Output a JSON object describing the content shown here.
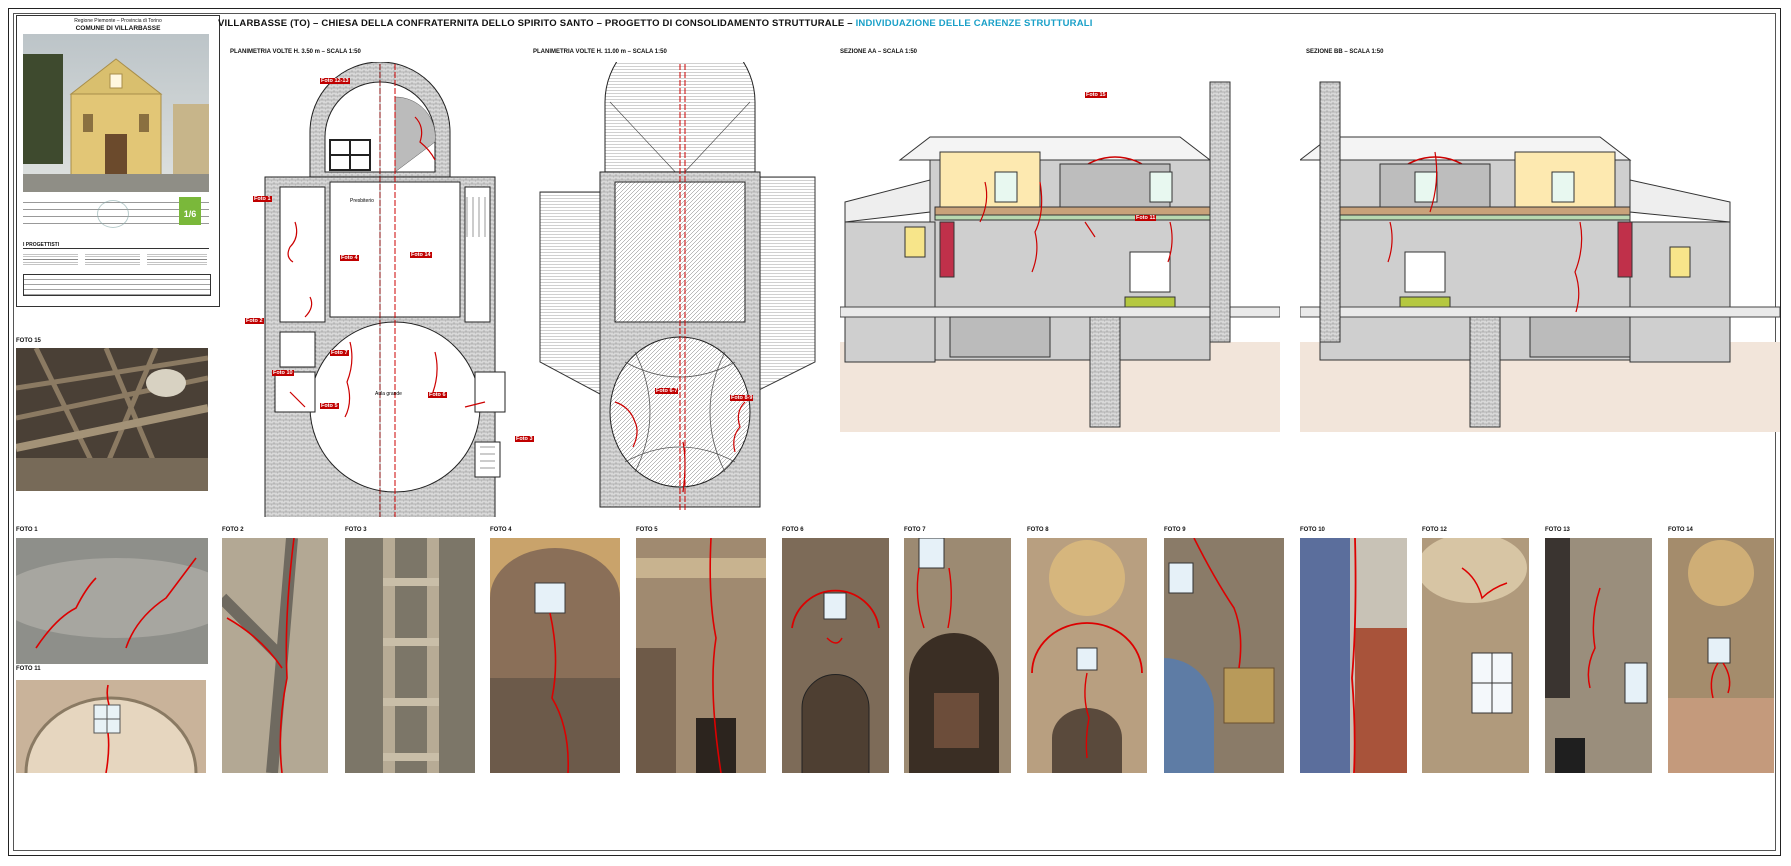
{
  "title_block": {
    "region": "Regione Piemonte – Provincia di Torino",
    "comune": "COMUNE DI VILLARBASSE",
    "sheet_number": "1/6",
    "designers_heading": "I PROGETTISTI"
  },
  "header": {
    "title_main": "VILLARBASSE (TO) – CHIESA DELLA CONFRATERNITA DELLO SPIRITO SANTO – PROGETTO DI CONSOLIDAMENTO STRUTTURALE –",
    "title_highlight": "INDIVIDUAZIONE DELLE CARENZE STRUTTURALI"
  },
  "drawings": {
    "plan1_label": "PLANIMETRIA VOLTE H. 3.50 m – SCALA 1:50",
    "plan2_label": "PLANIMETRIA VOLTE H. 11.00 m – SCALA 1:50",
    "section_aa_label": "SEZIONE AA – SCALA 1:50",
    "section_bb_label": "SEZIONE BB – SCALA 1:50"
  },
  "plan_rooms": {
    "presbiterio": "Presbiterio",
    "aula": "Aula grande"
  },
  "annotations": [
    "Foto 12-13",
    "Foto 1",
    "Foto 4",
    "Foto 14",
    "Foto 2",
    "Foto 10",
    "Foto 7",
    "Foto 6",
    "Foto 5",
    "Foto 3",
    "Foto 6-7",
    "Foto 8-9",
    "Foto 11",
    "Foto 15"
  ],
  "photos": {
    "foto15": "FOTO 15",
    "foto1": "FOTO 1",
    "foto11": "FOTO 11",
    "foto2": "FOTO 2",
    "foto3": "FOTO 3",
    "foto4": "FOTO 4",
    "foto5": "FOTO 5",
    "foto6": "FOTO 6",
    "foto7": "FOTO 7",
    "foto8": "FOTO 8",
    "foto9": "FOTO 9",
    "foto10": "FOTO 10",
    "foto12": "FOTO 12",
    "foto13": "FOTO 13",
    "foto14": "FOTO 14"
  },
  "colors": {
    "crack": "#cc0000",
    "highlight": "#1aa0c8",
    "badge": "#7ab83a"
  }
}
